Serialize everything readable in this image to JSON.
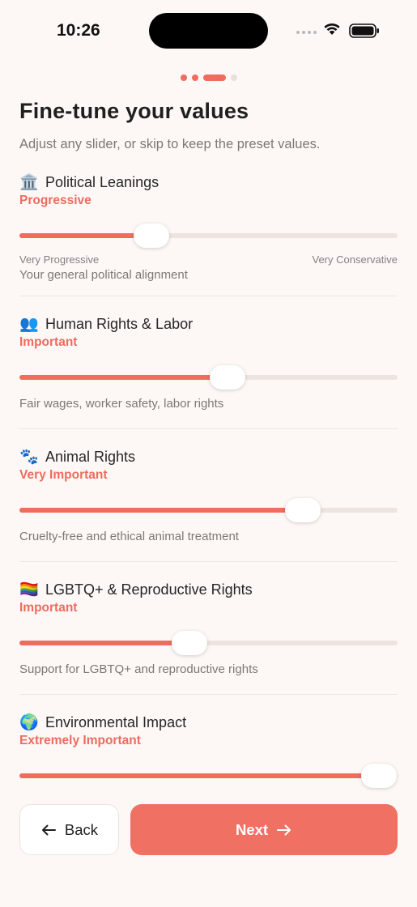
{
  "status_bar": {
    "time": "10:26"
  },
  "progress": {
    "steps": 4,
    "current": 3
  },
  "header": {
    "title": "Fine-tune your values",
    "subtitle": "Adjust any slider, or skip to keep the preset values."
  },
  "preferences": [
    {
      "icon": "🏛️",
      "icon_name": "classical-building-icon",
      "title": "Political Leanings",
      "level": "Progressive",
      "slider_fraction": 0.35,
      "left_label": "Very Progressive",
      "right_label": "Very Conservative",
      "description": "Your general political alignment"
    },
    {
      "icon": "👥",
      "icon_name": "people-icon",
      "title": "Human Rights & Labor",
      "level": "Important",
      "slider_fraction": 0.55,
      "description": "Fair wages, worker safety, labor rights"
    },
    {
      "icon": "🐾",
      "icon_name": "paw-prints-icon",
      "title": "Animal Rights",
      "level": "Very Important",
      "slider_fraction": 0.75,
      "description": "Cruelty-free and ethical animal treatment"
    },
    {
      "icon": "🏳️‍🌈",
      "icon_name": "rainbow-flag-icon",
      "title": "LGBTQ+ & Reproductive Rights",
      "level": "Important",
      "slider_fraction": 0.45,
      "description": "Support for LGBTQ+ and reproductive rights"
    },
    {
      "icon": "🌍",
      "icon_name": "globe-icon",
      "title": "Environmental Impact",
      "level": "Extremely Important",
      "slider_fraction": 0.95
    }
  ],
  "buttons": {
    "back": "Back",
    "next": "Next"
  },
  "colors": {
    "accent": "#ef6d5f",
    "background": "#fdf8f5",
    "track": "#eee4df"
  }
}
